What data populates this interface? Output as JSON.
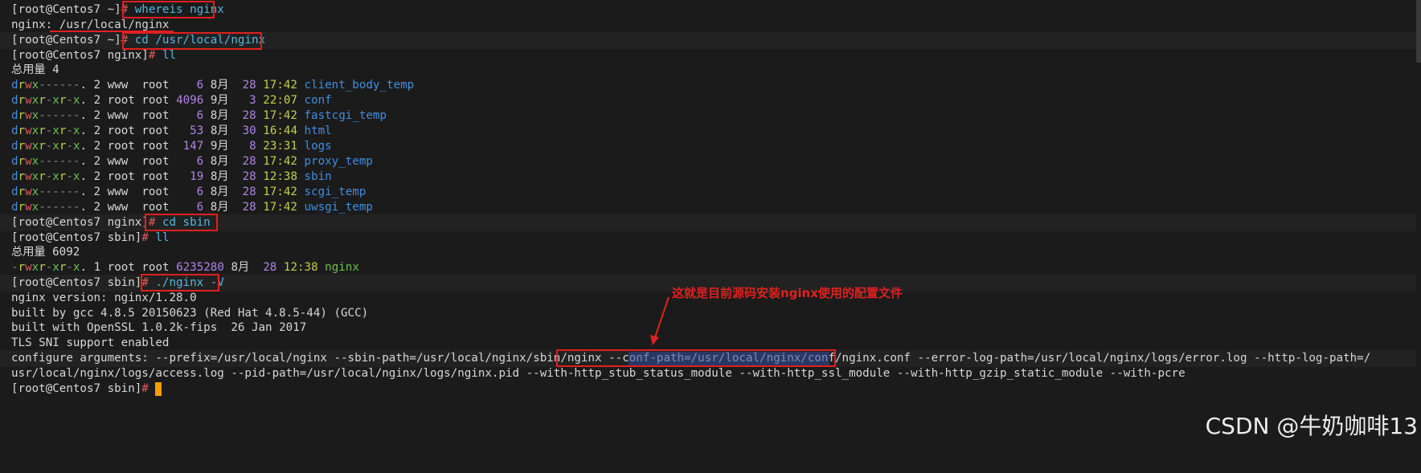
{
  "prompt_user": "root",
  "prompt_host": "Centos7",
  "lines": [
    {
      "prompt": "[root@Centos7 ~]",
      "cmd": "whereis nginx"
    },
    {
      "text": "nginx: /usr/local/nginx"
    },
    {
      "prompt": "[root@Centos7 ~]",
      "cmd": "cd /usr/local/nginx"
    },
    {
      "prompt": "[root@Centos7 nginx]",
      "cmd": "ll"
    },
    {
      "text": "总用量 4"
    },
    {
      "ls": [
        "drwx------.",
        "2",
        "www ",
        "root",
        "   6",
        "8月",
        "28",
        "17:42",
        "client_body_temp"
      ]
    },
    {
      "ls": [
        "drwxr-xr-x.",
        "2",
        "root",
        "root",
        "4096",
        "9月",
        " 3",
        "22:07",
        "conf"
      ]
    },
    {
      "ls": [
        "drwx------.",
        "2",
        "www ",
        "root",
        "   6",
        "8月",
        "28",
        "17:42",
        "fastcgi_temp"
      ]
    },
    {
      "ls": [
        "drwxr-xr-x.",
        "2",
        "root",
        "root",
        "  53",
        "8月",
        "30",
        "16:44",
        "html"
      ]
    },
    {
      "ls": [
        "drwxr-xr-x.",
        "2",
        "root",
        "root",
        " 147",
        "9月",
        " 8",
        "23:31",
        "logs"
      ]
    },
    {
      "ls": [
        "drwx------.",
        "2",
        "www ",
        "root",
        "   6",
        "8月",
        "28",
        "17:42",
        "proxy_temp"
      ]
    },
    {
      "ls": [
        "drwxr-xr-x.",
        "2",
        "root",
        "root",
        "  19",
        "8月",
        "28",
        "12:38",
        "sbin"
      ]
    },
    {
      "ls": [
        "drwx------.",
        "2",
        "www ",
        "root",
        "   6",
        "8月",
        "28",
        "17:42",
        "scgi_temp"
      ]
    },
    {
      "ls": [
        "drwx------.",
        "2",
        "www ",
        "root",
        "   6",
        "8月",
        "28",
        "17:42",
        "uwsgi_temp"
      ]
    },
    {
      "prompt": "[root@Centos7 nginx]",
      "cmd": "cd sbin"
    },
    {
      "prompt": "[root@Centos7 sbin]",
      "cmd": "ll"
    },
    {
      "text": "总用量 6092"
    },
    {
      "ls": [
        "-rwxr-xr-x.",
        "1",
        "root",
        "root",
        "6235280",
        "8月",
        "28",
        "12:38",
        "nginx"
      ]
    },
    {
      "prompt": "[root@Centos7 sbin]",
      "cmd": "./nginx -V"
    },
    {
      "text": "nginx version: nginx/1.28.0"
    },
    {
      "text": "built by gcc 4.8.5 20150623 (Red Hat 4.8.5-44) (GCC)"
    },
    {
      "text": "built with OpenSSL 1.0.2k-fips  26 Jan 2017"
    },
    {
      "text": "TLS SNI support enabled"
    },
    {
      "text": "configure arguments: --prefix=/usr/local/nginx --sbin-path=/usr/local/nginx/sbin/nginx --conf-path=/usr/local/nginx/conf/nginx.conf --error-log-path=/usr/local/nginx/logs/error.log --http-log-path=/"
    },
    {
      "text": "usr/local/nginx/logs/access.log --pid-path=/usr/local/nginx/logs/nginx.pid --with-http_stub_status_module --with-http_ssl_module --with-http_gzip_static_module --with-pcre"
    },
    {
      "prompt": "[root@Centos7 sbin]",
      "cmd": ""
    }
  ],
  "annotation": "这就是目前源码安装nginx使用的配置文件",
  "watermark": "CSDN @牛奶咖啡13",
  "colors": {
    "highlight_box": "#e02020",
    "selection": "#2f4a9a",
    "cursor": "#f0a000"
  }
}
